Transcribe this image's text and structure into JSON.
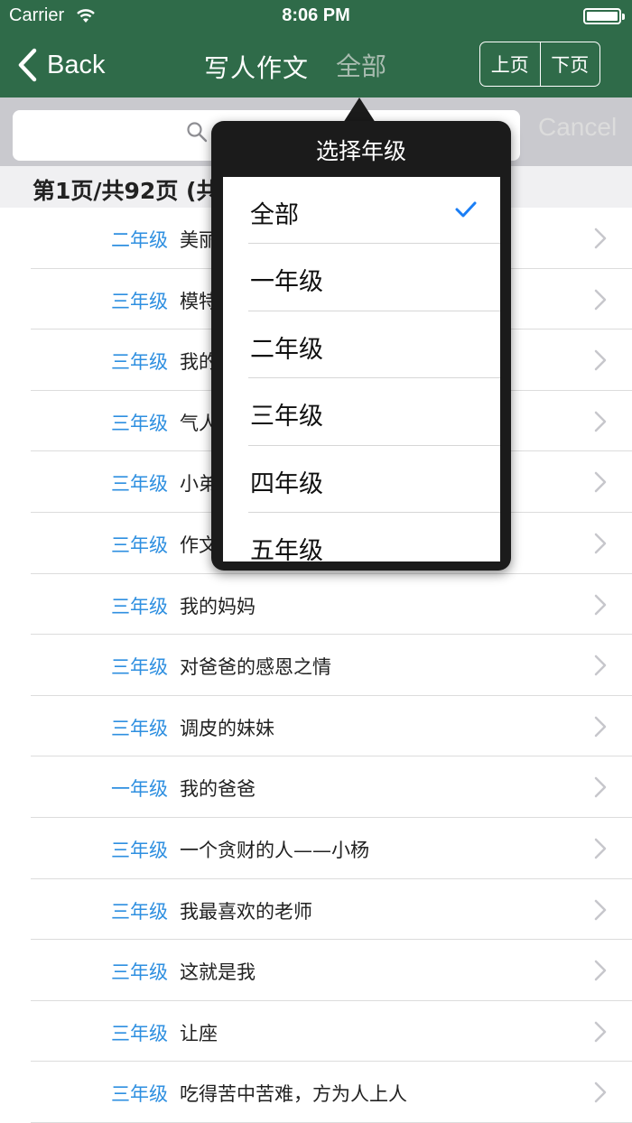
{
  "status_bar": {
    "carrier": "Carrier",
    "time": "8:06 PM"
  },
  "nav": {
    "back_label": "Back",
    "title": "写人作文",
    "filter_label": "全部",
    "prev_page": "上页",
    "next_page": "下页"
  },
  "search": {
    "placeholder": "",
    "cancel_label": "Cancel"
  },
  "section": {
    "header": "第1页/共92页 (共"
  },
  "list": [
    {
      "grade": "二年级",
      "title": "美丽"
    },
    {
      "grade": "三年级",
      "title": "模特"
    },
    {
      "grade": "三年级",
      "title": "我的"
    },
    {
      "grade": "三年级",
      "title": "气人"
    },
    {
      "grade": "三年级",
      "title": "小弟"
    },
    {
      "grade": "三年级",
      "title": "作文"
    },
    {
      "grade": "三年级",
      "title": "我的妈妈"
    },
    {
      "grade": "三年级",
      "title": "对爸爸的感恩之情"
    },
    {
      "grade": "三年级",
      "title": "调皮的妹妹"
    },
    {
      "grade": "一年级",
      "title": "我的爸爸"
    },
    {
      "grade": "三年级",
      "title": "一个贪财的人——小杨"
    },
    {
      "grade": "三年级",
      "title": "我最喜欢的老师"
    },
    {
      "grade": "三年级",
      "title": "这就是我"
    },
    {
      "grade": "三年级",
      "title": "让座"
    },
    {
      "grade": "三年级",
      "title": "吃得苦中苦难，方为人上人"
    }
  ],
  "popover": {
    "title": "选择年级",
    "options": [
      {
        "label": "全部",
        "selected": true
      },
      {
        "label": "一年级",
        "selected": false
      },
      {
        "label": "二年级",
        "selected": false
      },
      {
        "label": "三年级",
        "selected": false
      },
      {
        "label": "四年级",
        "selected": false
      },
      {
        "label": "五年级",
        "selected": false
      }
    ]
  },
  "colors": {
    "nav_green": "#2f6b49",
    "grade_blue": "#2e8fe0",
    "check_blue": "#1a7ef5",
    "popover_dark": "#1b1b1b"
  }
}
